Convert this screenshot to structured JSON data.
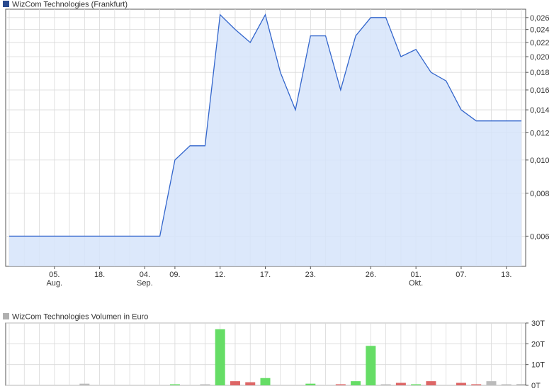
{
  "colors": {
    "price_line": "#3366cc",
    "price_fill": "#d6e4fa",
    "grid": "#d9d9d9",
    "axis": "#555555",
    "legend_price": "#2a4a8f",
    "legend_volume": "#b0b0b0",
    "vol_up": "#66dd66",
    "vol_down": "#dd6666",
    "vol_neutral": "#bbbbbb"
  },
  "chart_data": [
    {
      "type": "area",
      "legend": "WizCom Technologies (Frankfurt)",
      "y_scale": "log",
      "ylim": [
        0.0049,
        0.0275
      ],
      "y_ticks": [
        0.006,
        0.008,
        0.01,
        0.012,
        0.014,
        0.016,
        0.018,
        0.02,
        0.022,
        0.024,
        0.026
      ],
      "y_tick_labels": [
        "0,006",
        "0,008",
        "0,010",
        "0,012",
        "0,014",
        "0,016",
        "0,018",
        "0,020",
        "0,022",
        "0,024",
        "0,026"
      ],
      "x_ticks": [
        {
          "top": "05.",
          "bottom": "Aug."
        },
        {
          "top": "18.",
          "bottom": ""
        },
        {
          "top": "04.",
          "bottom": "Sep."
        },
        {
          "top": "09.",
          "bottom": ""
        },
        {
          "top": "12.",
          "bottom": ""
        },
        {
          "top": "17.",
          "bottom": ""
        },
        {
          "top": "23.",
          "bottom": ""
        },
        {
          "top": "26.",
          "bottom": ""
        },
        {
          "top": "01.",
          "bottom": "Okt."
        },
        {
          "top": "07.",
          "bottom": ""
        },
        {
          "top": "13.",
          "bottom": ""
        }
      ],
      "grid": true,
      "values": [
        0.006,
        0.006,
        0.006,
        0.006,
        0.006,
        0.006,
        0.006,
        0.006,
        0.006,
        0.006,
        0.006,
        0.01,
        0.011,
        0.011,
        0.0265,
        0.024,
        0.022,
        0.0265,
        0.018,
        0.014,
        0.023,
        0.023,
        0.016,
        0.023,
        0.026,
        0.026,
        0.02,
        0.021,
        0.018,
        0.017,
        0.014,
        0.013,
        0.013,
        0.013,
        0.013
      ]
    },
    {
      "type": "bar",
      "legend": "WizCom Technologies Volumen in Euro",
      "ylim": [
        0,
        30
      ],
      "y_ticks": [
        0,
        10,
        20,
        30
      ],
      "y_tick_labels": [
        "0T",
        "10T",
        "20T",
        "30T"
      ],
      "grid": true,
      "bars": [
        {
          "value": 0.0,
          "dir": "neutral"
        },
        {
          "value": 0.0,
          "dir": "neutral"
        },
        {
          "value": 0.0,
          "dir": "neutral"
        },
        {
          "value": 0.0,
          "dir": "neutral"
        },
        {
          "value": 0.0,
          "dir": "neutral"
        },
        {
          "value": 0.8,
          "dir": "neutral"
        },
        {
          "value": 0.0,
          "dir": "neutral"
        },
        {
          "value": 0.0,
          "dir": "neutral"
        },
        {
          "value": 0.0,
          "dir": "neutral"
        },
        {
          "value": 0.0,
          "dir": "neutral"
        },
        {
          "value": 0.0,
          "dir": "neutral"
        },
        {
          "value": 0.5,
          "dir": "up"
        },
        {
          "value": 0.0,
          "dir": "neutral"
        },
        {
          "value": 0.4,
          "dir": "neutral"
        },
        {
          "value": 27.0,
          "dir": "up"
        },
        {
          "value": 2.0,
          "dir": "down"
        },
        {
          "value": 1.5,
          "dir": "down"
        },
        {
          "value": 3.5,
          "dir": "up"
        },
        {
          "value": 0.0,
          "dir": "neutral"
        },
        {
          "value": 0.0,
          "dir": "neutral"
        },
        {
          "value": 0.8,
          "dir": "up"
        },
        {
          "value": 0.0,
          "dir": "neutral"
        },
        {
          "value": 0.5,
          "dir": "down"
        },
        {
          "value": 2.0,
          "dir": "up"
        },
        {
          "value": 19.0,
          "dir": "up"
        },
        {
          "value": 0.3,
          "dir": "neutral"
        },
        {
          "value": 1.2,
          "dir": "down"
        },
        {
          "value": 0.5,
          "dir": "up"
        },
        {
          "value": 2.0,
          "dir": "down"
        },
        {
          "value": 0.0,
          "dir": "neutral"
        },
        {
          "value": 1.2,
          "dir": "down"
        },
        {
          "value": 0.5,
          "dir": "down"
        },
        {
          "value": 2.0,
          "dir": "neutral"
        },
        {
          "value": 0.3,
          "dir": "neutral"
        },
        {
          "value": 0.6,
          "dir": "neutral"
        }
      ]
    }
  ]
}
